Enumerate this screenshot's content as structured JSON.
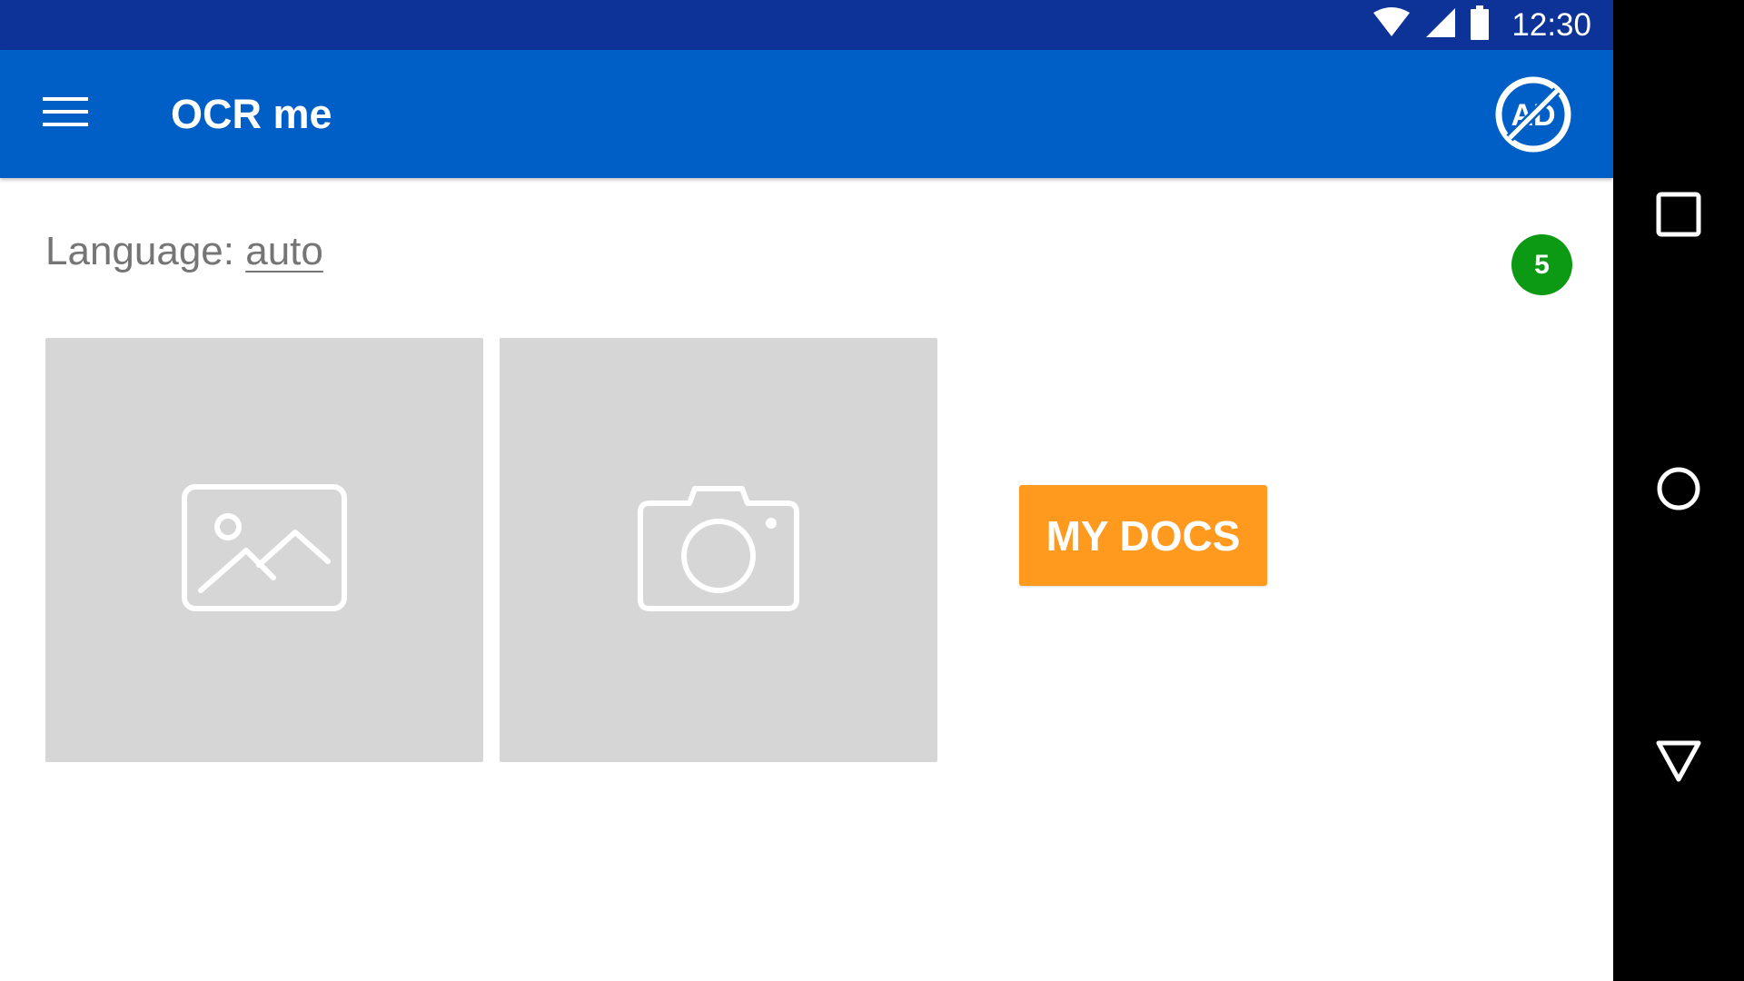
{
  "status_bar": {
    "time": "12:30",
    "icons": [
      "wifi-icon",
      "signal-icon",
      "battery-icon"
    ],
    "background": "#0d3399"
  },
  "app_bar": {
    "title": "OCR me",
    "menu_icon": "hamburger-menu-icon",
    "no_ads_icon": "no-ads-icon",
    "no_ads_text": "AD",
    "background": "#005fc7"
  },
  "content": {
    "language_label": "Language: ",
    "language_value": "auto",
    "badge_count": "5",
    "badge_color": "#0c9a14",
    "tiles": [
      {
        "name": "gallery",
        "icon": "image-icon"
      },
      {
        "name": "camera",
        "icon": "camera-icon"
      }
    ],
    "my_docs_label": "MY DOCS",
    "my_docs_color": "#ff9a1e"
  },
  "navigation": {
    "buttons": [
      "recents-icon",
      "home-icon",
      "back-icon"
    ]
  }
}
